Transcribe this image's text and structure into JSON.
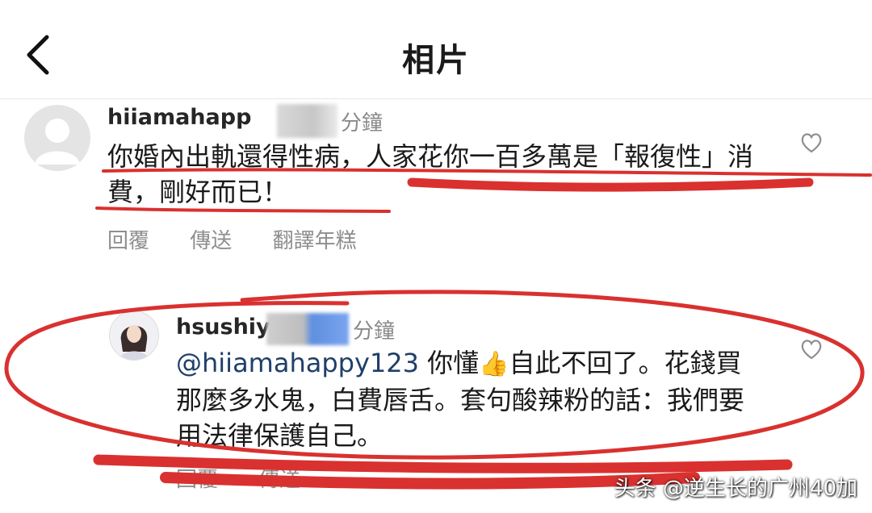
{
  "header": {
    "title": "相片"
  },
  "comments": [
    {
      "username": "hiiamahapp",
      "time": "分鐘",
      "text": "你婚內出軌還得性病，人家花你一百多萬是「報復性」消費，剛好而已！",
      "actions": [
        "回覆",
        "傳送",
        "翻譯年糕"
      ]
    },
    {
      "username": "hsushiy",
      "time": "分鐘",
      "mention": "@hiiamahappy123",
      "text_before": " 你懂",
      "emoji": "👍",
      "text_after": "自此不回了。花錢買那麼多水鬼，白費唇舌。套句酸辣粉的話：我們要用法律保護自己。",
      "actions": [
        "回覆",
        "傳送"
      ]
    }
  ],
  "watermark": "头条 @逆生长的广州40加",
  "colors": {
    "annotation": "#d9312f",
    "muted": "#8e8e8e"
  }
}
